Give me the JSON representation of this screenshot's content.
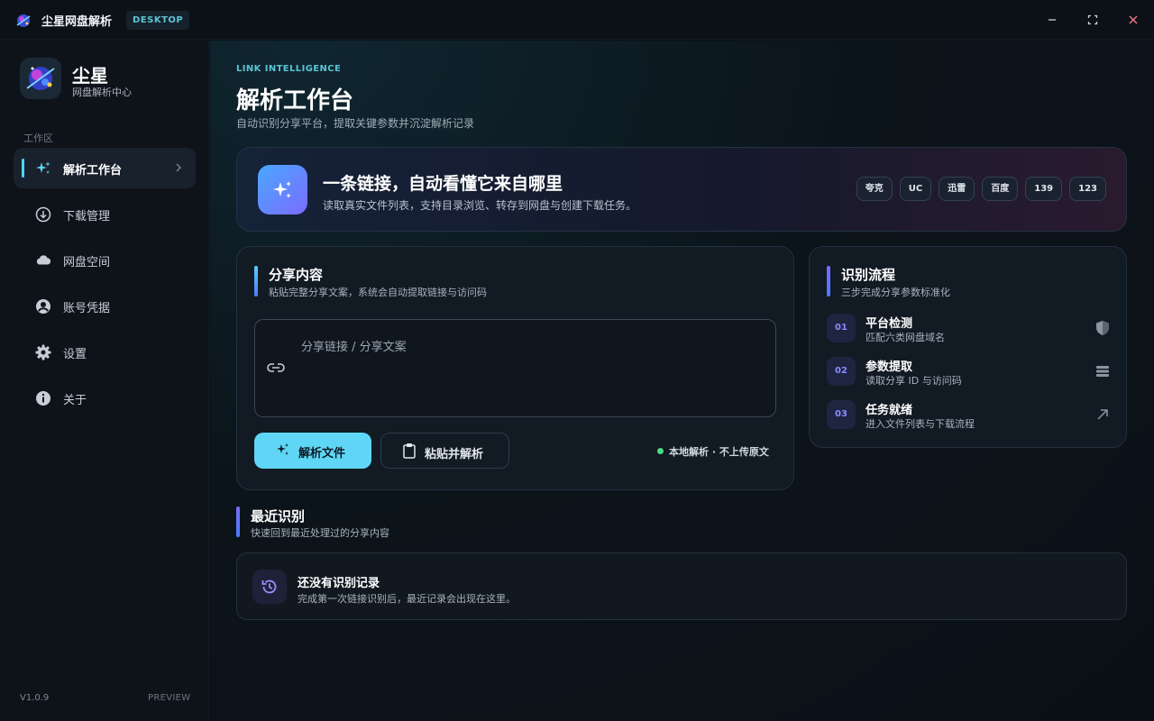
{
  "titlebar": {
    "app_name": "尘星网盘解析",
    "platform_badge": "DESKTOP"
  },
  "sidebar": {
    "brand_title": "尘星",
    "brand_sub": "网盘解析中心",
    "section_label": "工作区",
    "items": [
      {
        "label": "解析工作台",
        "icon": "sparkles-icon",
        "active": true
      },
      {
        "label": "下载管理",
        "icon": "download-icon",
        "active": false
      },
      {
        "label": "网盘空间",
        "icon": "cloud-icon",
        "active": false
      },
      {
        "label": "账号凭据",
        "icon": "user-circle-icon",
        "active": false
      },
      {
        "label": "设置",
        "icon": "gear-icon",
        "active": false
      },
      {
        "label": "关于",
        "icon": "info-icon",
        "active": false
      }
    ],
    "version": "V1.0.9",
    "preview": "PREVIEW"
  },
  "main": {
    "eyebrow": "LINK INTELLIGENCE",
    "title": "解析工作台",
    "subtitle": "自动识别分享平台，提取关键参数并沉淀解析记录",
    "hero": {
      "title": "一条链接，自动看懂它来自哪里",
      "subtitle": "读取真实文件列表，支持目录浏览、转存到网盘与创建下载任务。",
      "platforms": [
        "夸克",
        "UC",
        "迅雷",
        "百度",
        "139",
        "123"
      ]
    },
    "share": {
      "title": "分享内容",
      "subtitle": "粘贴完整分享文案，系统会自动提取链接与访问码",
      "placeholder": "分享链接 / 分享文案",
      "parse_button": "解析文件",
      "paste_button": "粘贴并解析",
      "local_note": "本地解析 · 不上传原文"
    },
    "flow": {
      "title": "识别流程",
      "subtitle": "三步完成分享参数标准化",
      "steps": [
        {
          "num": "01",
          "title": "平台检测",
          "sub": "匹配六类网盘域名",
          "icon": "shield-icon"
        },
        {
          "num": "02",
          "title": "参数提取",
          "sub": "读取分享 ID 与访问码",
          "icon": "list-icon"
        },
        {
          "num": "03",
          "title": "任务就绪",
          "sub": "进入文件列表与下载流程",
          "icon": "arrow-up-right-icon"
        }
      ]
    },
    "recent": {
      "title": "最近识别",
      "subtitle": "快速回到最近处理过的分享内容",
      "empty_title": "还没有识别记录",
      "empty_sub": "完成第一次链接识别后，最近记录会出现在这里。"
    }
  },
  "colors": {
    "accent": "#5fd6f5",
    "accent_purple": "#7a6bff",
    "background": "#0b1016",
    "success_dot": "#4ade80"
  }
}
